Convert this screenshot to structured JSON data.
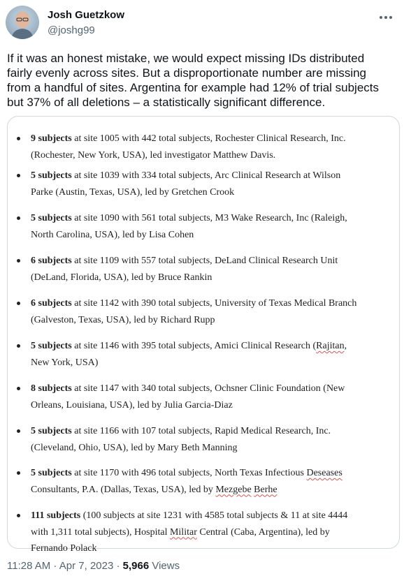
{
  "author": {
    "name": "Josh Guetzkow",
    "handle": "@joshg99"
  },
  "tweet": {
    "text_line1": "If it was an honest mistake, we would expect missing IDs distributed",
    "text_line2": "fairly evenly across sites. But a disproportionate number are missing",
    "text_line3": "from a handful of sites. Argentina for example had 12% of trial subjects",
    "text_line4": "but 37% of all deletions – a statistically significant difference."
  },
  "list": [
    {
      "bold": "9 subjects",
      "l1": " at site 1005 with 442 total subjects, Rochester Clinical Research, Inc.",
      "l2": "(Rochester, New York, USA), led investigator Matthew Davis."
    },
    {
      "bold": "5 subjects",
      "l1": " at site 1039 with 334 total subjects, Arc Clinical Research at Wilson",
      "l2": "Parke (Austin, Texas, USA), led by Gretchen Crook"
    },
    {
      "bold": "5 subjects",
      "l1": " at site 1090 with 561 total subjects, M3 Wake Research, Inc (Raleigh,",
      "l2": "North Carolina, USA), led by Lisa Cohen"
    },
    {
      "bold": "6 subjects",
      "l1": " at site 1109 with 557 total subjects, DeLand Clinical Research Unit",
      "l2": "(DeLand, Florida, USA), led by Bruce Rankin"
    },
    {
      "bold": "6 subjects",
      "l1": " at site 1142 with 390 total subjects, University of Texas Medical Branch",
      "l2": "(Galveston, Texas, USA), led by Richard Rupp"
    },
    {
      "bold": "5 subjects",
      "l1a": " at site 1146 with 395 total subjects, Amici Clinical Research (",
      "l1sq": "Rajitan",
      "l1b": ",",
      "l2": "New York, USA)"
    },
    {
      "bold": "8 subjects",
      "l1": " at site 1147 with 340 total subjects, Ochsner Clinic Foundation (New",
      "l2": "Orleans, Louisiana, USA), led by Julia Garcia-Diaz"
    },
    {
      "bold": "5 subjects",
      "l1": " at site 1166 with 107 total subjects, Rapid Medical Research, Inc.",
      "l2": "(Cleveland, Ohio, USA), led by Mary Beth Manning"
    },
    {
      "bold": "5 subjects",
      "l1a": " at site 1170 with 496 total subjects, North Texas Infectious ",
      "l1sq": "Deseases",
      "l2a": "Consultants, P.A. (Dallas, Texas, USA), led by ",
      "l2sq1": "Mezgebe",
      "l2sp": " ",
      "l2sq2": "Berhe"
    },
    {
      "bold": "111 subjects",
      "l1": " (100 subjects at site 1231 with 4585 total subjects & 11 at site 4444",
      "l2a": "with 1,311 total subjects), Hospital ",
      "l2sq": "Militar",
      "l2b": " Central (Caba, Argentina), led by",
      "l3": "Fernando Polack"
    }
  ],
  "meta": {
    "time": "11:28 AM · Apr 7, 2023 · ",
    "views_count": "5,966",
    "views_label": " Views"
  },
  "icons": {
    "more": "more-icon"
  }
}
